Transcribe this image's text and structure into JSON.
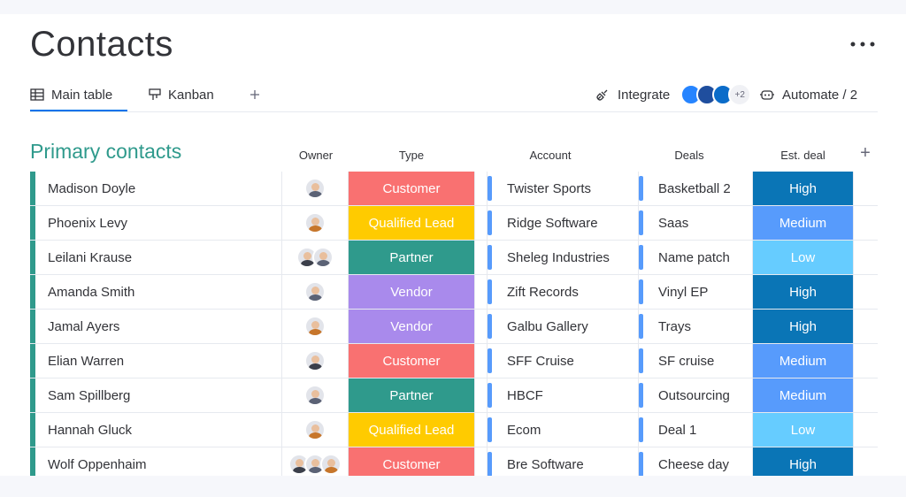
{
  "page": {
    "title": "Contacts"
  },
  "tabs": [
    {
      "label": "Main table",
      "icon": "table-icon"
    },
    {
      "label": "Kanban",
      "icon": "kanban-icon"
    }
  ],
  "toolbar": {
    "integrate_label": "Integrate",
    "integrate_more": "+2",
    "automate_label": "Automate / 2"
  },
  "group": {
    "title": "Primary contacts"
  },
  "columns": {
    "owner": "Owner",
    "type": "Type",
    "account": "Account",
    "deals": "Deals",
    "est": "Est. deal"
  },
  "colors": {
    "group": "#2f9a8c",
    "Customer": "#f97171",
    "Qualified Lead": "#ffcb00",
    "Partner": "#2f9a8c",
    "Vendor": "#a98aec",
    "High": "#0a75b6",
    "Medium": "#579bfc",
    "Low": "#66ccff"
  },
  "rows": [
    {
      "name": "Madison Doyle",
      "owners": 1,
      "type": "Customer",
      "account": "Twister Sports",
      "deal": "Basketball 2",
      "est": "High"
    },
    {
      "name": "Phoenix Levy",
      "owners": 1,
      "type": "Qualified Lead",
      "account": "Ridge Software",
      "deal": "Saas",
      "est": "Medium"
    },
    {
      "name": "Leilani Krause",
      "owners": 2,
      "type": "Partner",
      "account": "Sheleg Industries",
      "deal": "Name patch",
      "est": "Low"
    },
    {
      "name": "Amanda Smith",
      "owners": 1,
      "type": "Vendor",
      "account": "Zift Records",
      "deal": "Vinyl EP",
      "est": "High"
    },
    {
      "name": "Jamal Ayers",
      "owners": 1,
      "type": "Vendor",
      "account": "Galbu Gallery",
      "deal": "Trays",
      "est": "High"
    },
    {
      "name": "Elian Warren",
      "owners": 1,
      "type": "Customer",
      "account": "SFF Cruise",
      "deal": "SF cruise",
      "est": "Medium"
    },
    {
      "name": "Sam Spillberg",
      "owners": 1,
      "type": "Partner",
      "account": "HBCF",
      "deal": "Outsourcing",
      "est": "Medium"
    },
    {
      "name": "Hannah Gluck",
      "owners": 1,
      "type": "Qualified Lead",
      "account": "Ecom",
      "deal": "Deal 1",
      "est": "Low"
    },
    {
      "name": "Wolf Oppenhaim",
      "owners": 3,
      "type": "Customer",
      "account": "Bre Software",
      "deal": "Cheese day",
      "est": "High"
    }
  ]
}
